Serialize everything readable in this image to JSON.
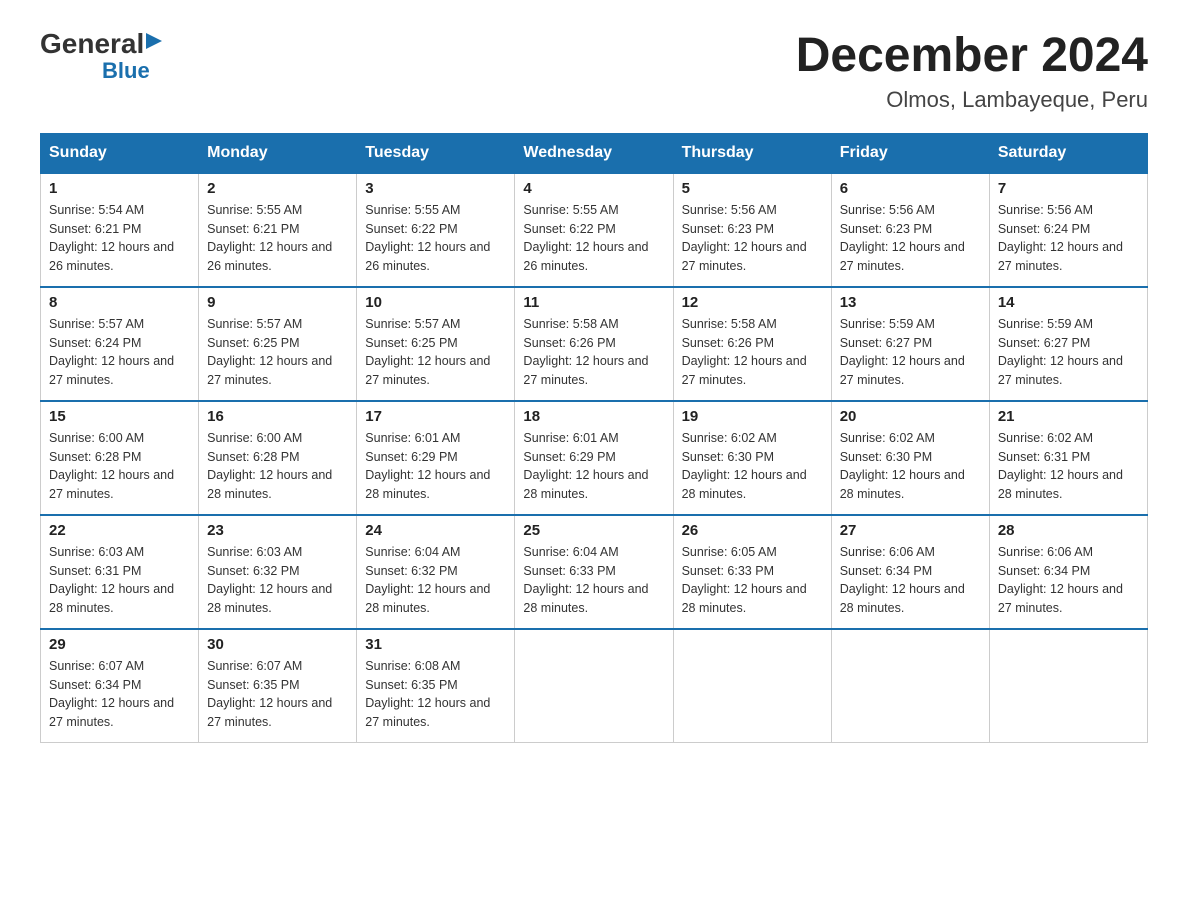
{
  "logo": {
    "general": "General",
    "blue": "Blue",
    "triangle": "▶"
  },
  "title": "December 2024",
  "subtitle": "Olmos, Lambayeque, Peru",
  "days_of_week": [
    "Sunday",
    "Monday",
    "Tuesday",
    "Wednesday",
    "Thursday",
    "Friday",
    "Saturday"
  ],
  "weeks": [
    [
      {
        "day": "1",
        "sunrise": "5:54 AM",
        "sunset": "6:21 PM",
        "daylight": "12 hours and 26 minutes."
      },
      {
        "day": "2",
        "sunrise": "5:55 AM",
        "sunset": "6:21 PM",
        "daylight": "12 hours and 26 minutes."
      },
      {
        "day": "3",
        "sunrise": "5:55 AM",
        "sunset": "6:22 PM",
        "daylight": "12 hours and 26 minutes."
      },
      {
        "day": "4",
        "sunrise": "5:55 AM",
        "sunset": "6:22 PM",
        "daylight": "12 hours and 26 minutes."
      },
      {
        "day": "5",
        "sunrise": "5:56 AM",
        "sunset": "6:23 PM",
        "daylight": "12 hours and 27 minutes."
      },
      {
        "day": "6",
        "sunrise": "5:56 AM",
        "sunset": "6:23 PM",
        "daylight": "12 hours and 27 minutes."
      },
      {
        "day": "7",
        "sunrise": "5:56 AM",
        "sunset": "6:24 PM",
        "daylight": "12 hours and 27 minutes."
      }
    ],
    [
      {
        "day": "8",
        "sunrise": "5:57 AM",
        "sunset": "6:24 PM",
        "daylight": "12 hours and 27 minutes."
      },
      {
        "day": "9",
        "sunrise": "5:57 AM",
        "sunset": "6:25 PM",
        "daylight": "12 hours and 27 minutes."
      },
      {
        "day": "10",
        "sunrise": "5:57 AM",
        "sunset": "6:25 PM",
        "daylight": "12 hours and 27 minutes."
      },
      {
        "day": "11",
        "sunrise": "5:58 AM",
        "sunset": "6:26 PM",
        "daylight": "12 hours and 27 minutes."
      },
      {
        "day": "12",
        "sunrise": "5:58 AM",
        "sunset": "6:26 PM",
        "daylight": "12 hours and 27 minutes."
      },
      {
        "day": "13",
        "sunrise": "5:59 AM",
        "sunset": "6:27 PM",
        "daylight": "12 hours and 27 minutes."
      },
      {
        "day": "14",
        "sunrise": "5:59 AM",
        "sunset": "6:27 PM",
        "daylight": "12 hours and 27 minutes."
      }
    ],
    [
      {
        "day": "15",
        "sunrise": "6:00 AM",
        "sunset": "6:28 PM",
        "daylight": "12 hours and 27 minutes."
      },
      {
        "day": "16",
        "sunrise": "6:00 AM",
        "sunset": "6:28 PM",
        "daylight": "12 hours and 28 minutes."
      },
      {
        "day": "17",
        "sunrise": "6:01 AM",
        "sunset": "6:29 PM",
        "daylight": "12 hours and 28 minutes."
      },
      {
        "day": "18",
        "sunrise": "6:01 AM",
        "sunset": "6:29 PM",
        "daylight": "12 hours and 28 minutes."
      },
      {
        "day": "19",
        "sunrise": "6:02 AM",
        "sunset": "6:30 PM",
        "daylight": "12 hours and 28 minutes."
      },
      {
        "day": "20",
        "sunrise": "6:02 AM",
        "sunset": "6:30 PM",
        "daylight": "12 hours and 28 minutes."
      },
      {
        "day": "21",
        "sunrise": "6:02 AM",
        "sunset": "6:31 PM",
        "daylight": "12 hours and 28 minutes."
      }
    ],
    [
      {
        "day": "22",
        "sunrise": "6:03 AM",
        "sunset": "6:31 PM",
        "daylight": "12 hours and 28 minutes."
      },
      {
        "day": "23",
        "sunrise": "6:03 AM",
        "sunset": "6:32 PM",
        "daylight": "12 hours and 28 minutes."
      },
      {
        "day": "24",
        "sunrise": "6:04 AM",
        "sunset": "6:32 PM",
        "daylight": "12 hours and 28 minutes."
      },
      {
        "day": "25",
        "sunrise": "6:04 AM",
        "sunset": "6:33 PM",
        "daylight": "12 hours and 28 minutes."
      },
      {
        "day": "26",
        "sunrise": "6:05 AM",
        "sunset": "6:33 PM",
        "daylight": "12 hours and 28 minutes."
      },
      {
        "day": "27",
        "sunrise": "6:06 AM",
        "sunset": "6:34 PM",
        "daylight": "12 hours and 28 minutes."
      },
      {
        "day": "28",
        "sunrise": "6:06 AM",
        "sunset": "6:34 PM",
        "daylight": "12 hours and 27 minutes."
      }
    ],
    [
      {
        "day": "29",
        "sunrise": "6:07 AM",
        "sunset": "6:34 PM",
        "daylight": "12 hours and 27 minutes."
      },
      {
        "day": "30",
        "sunrise": "6:07 AM",
        "sunset": "6:35 PM",
        "daylight": "12 hours and 27 minutes."
      },
      {
        "day": "31",
        "sunrise": "6:08 AM",
        "sunset": "6:35 PM",
        "daylight": "12 hours and 27 minutes."
      },
      null,
      null,
      null,
      null
    ]
  ]
}
